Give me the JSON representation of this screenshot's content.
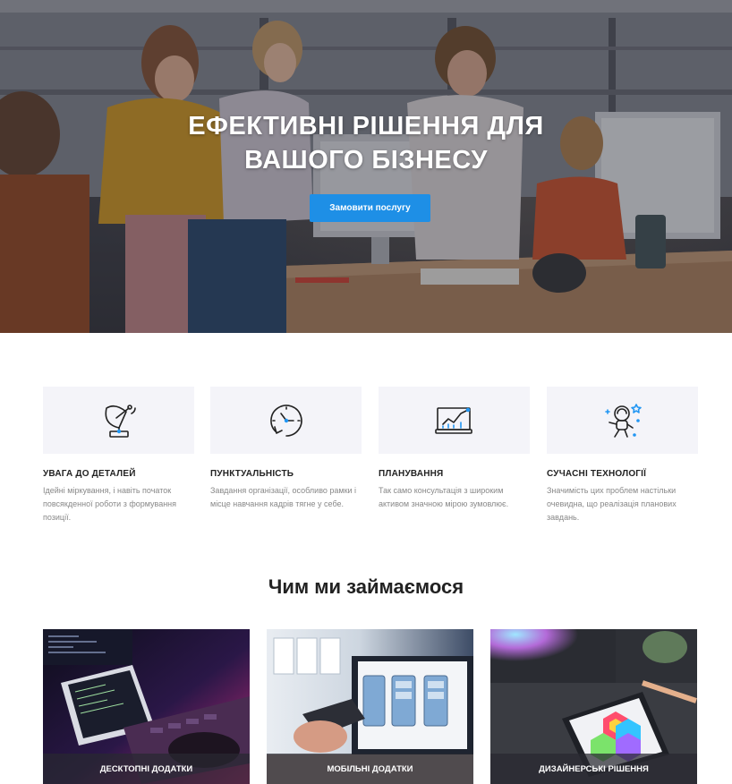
{
  "hero": {
    "title_line1": "ЕФЕКТИВНІ РІШЕННЯ ДЛЯ",
    "title_line2": "ВАШОГО БІЗНЕСУ",
    "cta_label": "Замовити послугу",
    "accent_color": "#1e8fe6"
  },
  "features": [
    {
      "icon": "satellite-dish-icon",
      "title": "УВАГА ДО ДЕТАЛЕЙ",
      "text": "Ідейні міркування, і навіть початок повсякденної роботи з формування позиції."
    },
    {
      "icon": "clock-icon",
      "title": "ПУНКТУАЛЬНІСТЬ",
      "text": "Завдання організації, особливо рамки і місце навчання кадрів тягне у себе."
    },
    {
      "icon": "analytics-monitor-icon",
      "title": "ПЛАНУВАННЯ",
      "text": "Так само консультація з широким активом значною мірою зумовлює."
    },
    {
      "icon": "astronaut-icon",
      "title": "СУЧАСНІ ТЕХНОЛОГІЇ",
      "text": "Значимість цих проблем настільки очевидна, що реалізація планових завдань."
    }
  ],
  "services_section": {
    "title": "Чим ми займаємося"
  },
  "services": [
    {
      "label": "ДЕСКТОПНІ ДОДАТКИ"
    },
    {
      "label": "МОБІЛЬНІ ДОДАТКИ"
    },
    {
      "label": "ДИЗАЙНЕРСЬКІ РІШЕННЯ"
    }
  ]
}
